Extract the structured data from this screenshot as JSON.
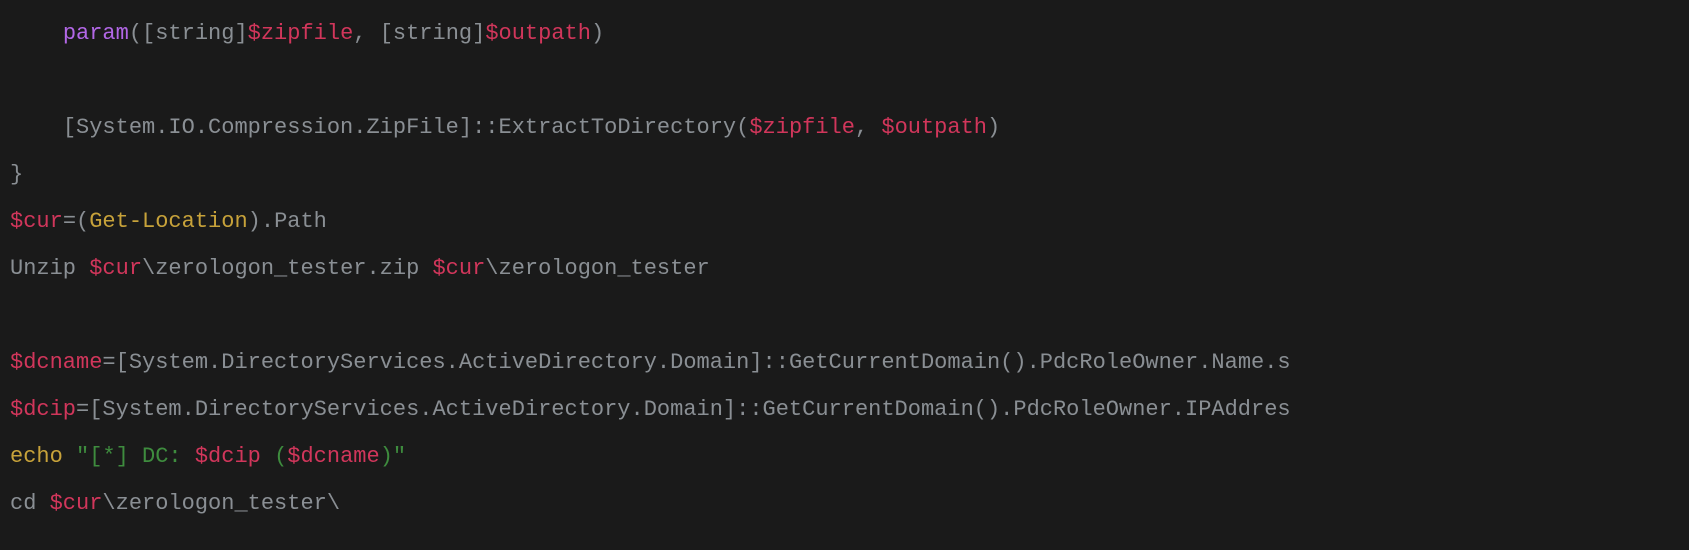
{
  "code": {
    "line1": {
      "indent": "    ",
      "param_kw": "param",
      "open": "(",
      "type1": "[string]",
      "var1": "$zipfile",
      "comma": ", ",
      "type2": "[string]",
      "var2": "$outpath",
      "close": ")"
    },
    "blank1": "",
    "line2": {
      "indent": "    ",
      "type": "[System.IO.Compression.ZipFile]",
      "dcolon": "::",
      "method": "ExtractToDirectory",
      "open": "(",
      "var1": "$zipfile",
      "comma": ", ",
      "var2": "$outpath",
      "close": ")"
    },
    "line3": {
      "brace": "}"
    },
    "line4": {
      "var": "$cur",
      "eq": "=",
      "open": "(",
      "fn": "Get-Location",
      "close": ")",
      "dot": ".",
      "prop": "Path"
    },
    "line5": {
      "fn": "Unzip ",
      "var1": "$cur",
      "path1": "\\zerologon_tester.zip ",
      "var2": "$cur",
      "path2": "\\zerologon_tester"
    },
    "blank2": "",
    "line6": {
      "var": "$dcname",
      "eq": "=",
      "type": "[System.DirectoryServices.ActiveDirectory.Domain]",
      "dcolon": "::",
      "method": "GetCurrentDomain",
      "parens": "()",
      "tail": ".PdcRoleOwner.Name.s"
    },
    "line7": {
      "var": "$dcip",
      "eq": "=",
      "type": "[System.DirectoryServices.ActiveDirectory.Domain]",
      "dcolon": "::",
      "method": "GetCurrentDomain",
      "parens": "()",
      "tail": ".PdcRoleOwner.IPAddres"
    },
    "line8": {
      "fn": "echo ",
      "q1": "\"",
      "lb": "[",
      "star": "*",
      "rb": "] ",
      "dc": "DC: ",
      "var1": "$dcip",
      "sp": " ",
      "open": "(",
      "var2": "$dcname",
      "close": ")",
      "q2": "\""
    },
    "line9": {
      "fn": "cd ",
      "var": "$cur",
      "path": "\\zerologon_tester\\"
    }
  }
}
